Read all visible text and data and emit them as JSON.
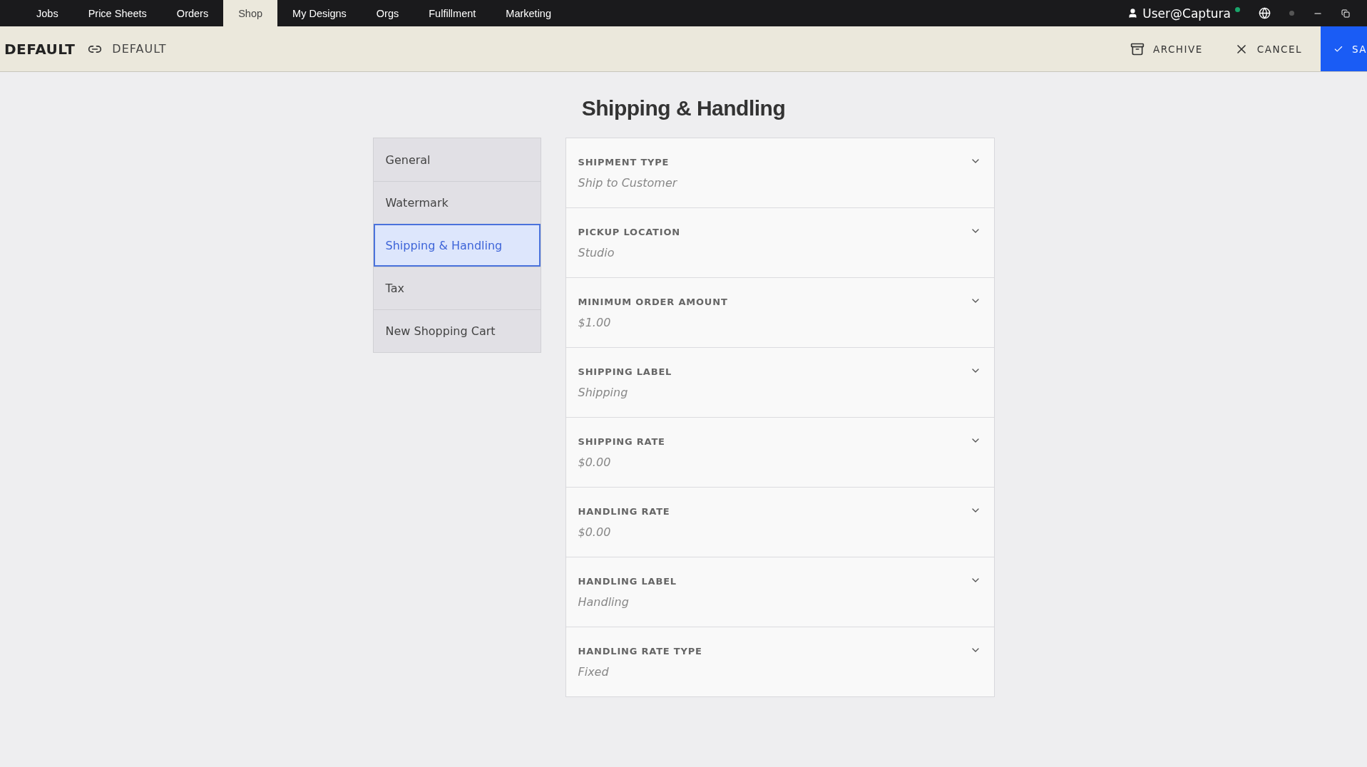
{
  "nav_tabs": [
    {
      "label": "Jobs",
      "selected": false
    },
    {
      "label": "Price Sheets",
      "selected": false
    },
    {
      "label": "Orders",
      "selected": false
    },
    {
      "label": "Shop",
      "selected": true
    },
    {
      "label": "My Designs",
      "selected": false
    },
    {
      "label": "Orgs",
      "selected": false
    },
    {
      "label": "Fulfillment",
      "selected": false
    },
    {
      "label": "Marketing",
      "selected": false
    }
  ],
  "user": {
    "name": "User@Captura",
    "online": true
  },
  "header": {
    "title": "DEFAULT",
    "linked_name": "DEFAULT",
    "actions": [
      {
        "kind": "archive",
        "label": "ARCHIVE"
      },
      {
        "kind": "cancel",
        "label": "CANCEL"
      },
      {
        "kind": "save",
        "label": "SA"
      }
    ]
  },
  "page_title": "Shipping & Handling",
  "sidebar": {
    "items": [
      {
        "label": "General",
        "selected": false
      },
      {
        "label": "Watermark",
        "selected": false
      },
      {
        "label": "Shipping & Handling",
        "selected": true
      },
      {
        "label": "Tax",
        "selected": false
      },
      {
        "label": "New Shopping Cart",
        "selected": false
      }
    ]
  },
  "fields": [
    {
      "label": "SHIPMENT TYPE",
      "value": "Ship to Customer"
    },
    {
      "label": "PICKUP LOCATION",
      "value": "Studio"
    },
    {
      "label": "MINIMUM ORDER AMOUNT",
      "value": "$1.00"
    },
    {
      "label": "SHIPPING LABEL",
      "value": "Shipping"
    },
    {
      "label": "SHIPPING RATE",
      "value": "$0.00"
    },
    {
      "label": "HANDLING RATE",
      "value": "$0.00"
    },
    {
      "label": "HANDLING LABEL",
      "value": "Handling"
    },
    {
      "label": "HANDLING RATE TYPE",
      "value": "Fixed"
    }
  ]
}
